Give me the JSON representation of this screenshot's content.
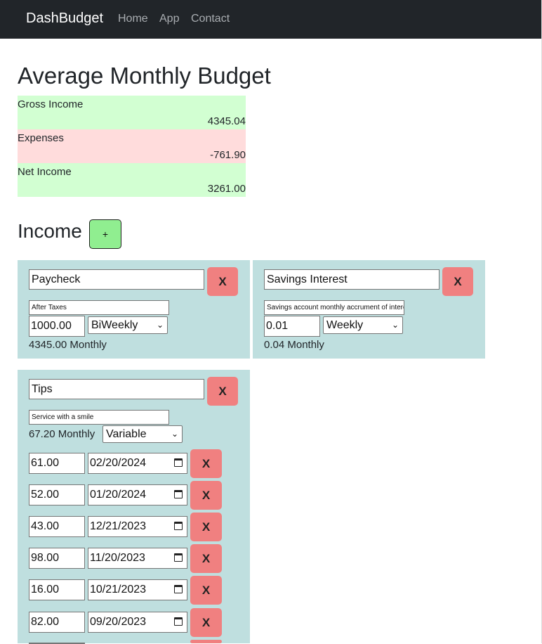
{
  "nav": {
    "brand": "DashBudget",
    "links": [
      "Home",
      "App",
      "Contact"
    ]
  },
  "page_title": "Average Monthly Budget",
  "summary": [
    {
      "label": "Gross Income",
      "value": "4345.04",
      "color": "#d2ffd2"
    },
    {
      "label": "Expenses",
      "value": "-761.90",
      "color": "#ffdcdc"
    },
    {
      "label": "Net Income",
      "value": "3261.00",
      "color": "#d2ffd2"
    }
  ],
  "income": {
    "title": "Income",
    "add_label": "+",
    "delete_label": "X",
    "cards": [
      {
        "name": "Paycheck",
        "description": "After Taxes",
        "amount": "1000.00",
        "frequency": "BiWeekly",
        "monthly_text": "4345.00 Monthly"
      },
      {
        "name": "Savings Interest",
        "description": "Savings account monthly accrument of interest",
        "amount": "0.01",
        "frequency": "Weekly",
        "monthly_text": "0.04 Monthly"
      },
      {
        "name": "Tips",
        "description": "Service with a smile",
        "monthly_text": "67.20 Monthly",
        "frequency": "Variable",
        "entries": [
          {
            "amount": "61.00",
            "date": "02/20/2024"
          },
          {
            "amount": "52.00",
            "date": "01/20/2024"
          },
          {
            "amount": "43.00",
            "date": "12/21/2023"
          },
          {
            "amount": "98.00",
            "date": "11/20/2023"
          },
          {
            "amount": "16.00",
            "date": "10/21/2023"
          },
          {
            "amount": "82.00",
            "date": "09/20/2023"
          }
        ]
      }
    ]
  },
  "colors": {
    "navbar": "#212529",
    "card": "#bfdfdf",
    "delete_button": "#f08080",
    "add_button": "#90ee90"
  }
}
